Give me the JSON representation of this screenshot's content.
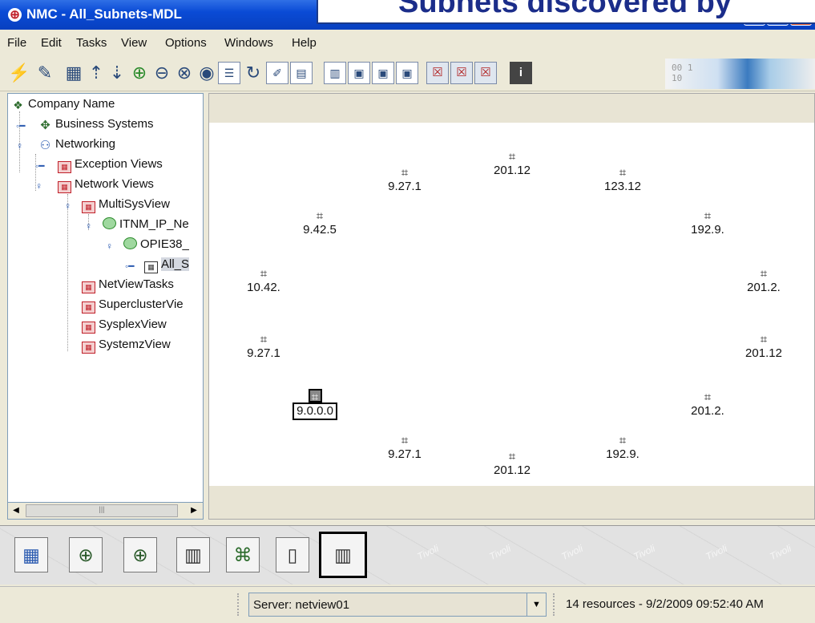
{
  "window": {
    "title": "NMC - All_Subnets-MDL",
    "overlay_title": "Subnets discovered by"
  },
  "menu": [
    "File",
    "Edit",
    "Tasks",
    "View",
    "Options",
    "Windows",
    "Help"
  ],
  "tree": {
    "nodes": [
      {
        "label": "Company Name",
        "icon": "company-icon"
      },
      {
        "label": "Business Systems",
        "icon": "business-systems-icon"
      },
      {
        "label": "Networking",
        "icon": "networking-icon"
      },
      {
        "label": "Exception Views",
        "icon": "view-folder-icon"
      },
      {
        "label": "Network Views",
        "icon": "view-folder-icon"
      },
      {
        "label": "MultiSysView",
        "icon": "view-folder-icon"
      },
      {
        "label": "ITNM_IP_Ne",
        "icon": "globe-icon"
      },
      {
        "label": "OPIE38_",
        "icon": "globe-icon"
      },
      {
        "label": "All_S",
        "icon": "subnet-grid-icon",
        "selected": true
      },
      {
        "label": "NetViewTasks",
        "icon": "view-folder-icon"
      },
      {
        "label": "SuperclusterVie",
        "icon": "view-folder-icon"
      },
      {
        "label": "SysplexView",
        "icon": "view-folder-icon"
      },
      {
        "label": "SystemzView",
        "icon": "view-folder-icon"
      }
    ]
  },
  "canvas": {
    "nodes": [
      {
        "label": "201.12"
      },
      {
        "label": "9.27.1"
      },
      {
        "label": "123.12"
      },
      {
        "label": "9.42.5"
      },
      {
        "label": "192.9."
      },
      {
        "label": "10.42."
      },
      {
        "label": "201.2."
      },
      {
        "label": "9.27.1"
      },
      {
        "label": "201.12"
      },
      {
        "label": "9.0.0.0",
        "selected": true
      },
      {
        "label": "201.2."
      },
      {
        "label": "9.27.1"
      },
      {
        "label": "192.9."
      },
      {
        "label": "201.12"
      }
    ]
  },
  "iconbar": {
    "buttons": [
      "view-icon",
      "globe-icon",
      "globe-icon",
      "building-icon",
      "topology-icon",
      "document-icon",
      "building-icon"
    ],
    "watermark": "Tivoli"
  },
  "status": {
    "server": "Server: netview01",
    "info": "14 resources - 9/2/2009 09:52:40 AM"
  }
}
